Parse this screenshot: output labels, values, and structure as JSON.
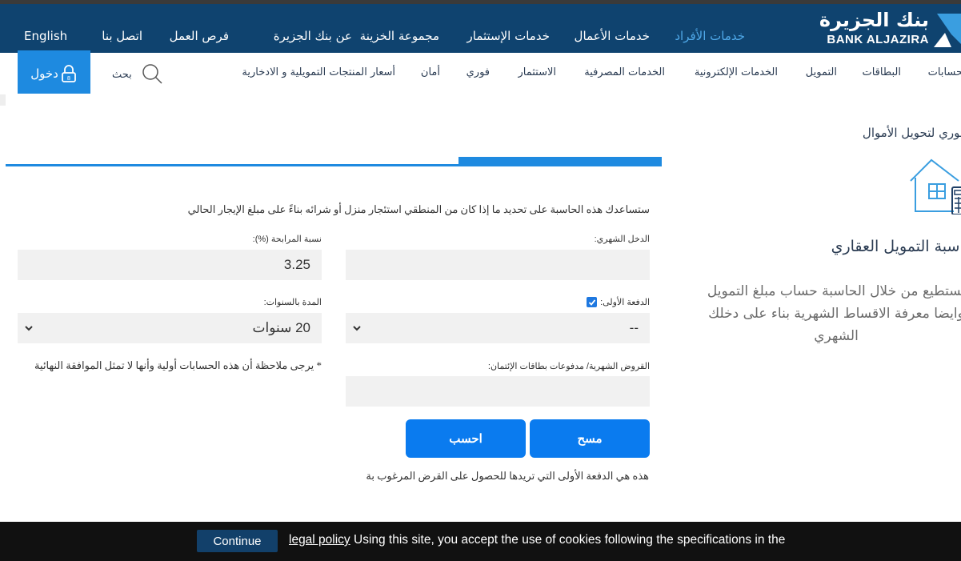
{
  "header": {
    "logo_ar": "بنك الجزيرة",
    "logo_en": "BANK ALJAZIRA",
    "nav": [
      {
        "label": "خدمات الأفراد",
        "active": true
      },
      {
        "label": "خدمات الأعمال",
        "active": false
      },
      {
        "label": "خدمات الإستثمار",
        "active": false
      },
      {
        "label": "مجموعة الخزينة",
        "active": false
      },
      {
        "label": "عن بنك الجزيرة",
        "active": false
      },
      {
        "label": "فرص العمل",
        "active": false
      },
      {
        "label": "اتصل بنا",
        "active": false
      },
      {
        "label": "English",
        "active": false
      }
    ],
    "accent_color": "#1e8ae0",
    "bar_color": "#0f436f"
  },
  "subnav": {
    "items": [
      "الحسابات",
      "البطاقات",
      "التمويل",
      "الخدمات الإلكترونية",
      "الخدمات المصرفية",
      "الاستثمار",
      "فوري",
      "أمان",
      "أسعار المنتجات التمويلية و الادخارية"
    ],
    "search_label": "بحث",
    "login_label": "دخول"
  },
  "sidebar": {
    "link": "فوري لتحويل الأموال",
    "title": "حاسبة التمويل العقاري",
    "description": "تستطيع من خلال الحاسبة حساب مبلغ التمويل وايضا معرفة الاقساط الشهرية بناء على دخلك الشهري"
  },
  "calculator": {
    "progress_fraction": 0.31,
    "intro": "ستساعدك هذه الحاسبة على تحديد ما إذا كان من المنطقي استئجار منزل أو شرائه بناءً على مبلغ الإيجار الحالي",
    "monthly_income": {
      "label": "الدخل الشهري:",
      "value": ""
    },
    "profit_rate": {
      "label": "نسبة المرابحة (%):",
      "value": "3.25"
    },
    "down_payment": {
      "label": "الدفعة الأولى:",
      "checked": true,
      "selected": "--"
    },
    "duration": {
      "label": "المدة بالسنوات:",
      "selected": "20 سنوات"
    },
    "monthly_loans": {
      "label": "القروض الشهرية/ مدفوعات بطاقات الإئتمان:",
      "value": ""
    },
    "note": "* يرجى ملاحظة أن هذه الحسابات أولية وأنها لا تمثل الموافقة النهائية",
    "clear_label": "مسح",
    "calculate_label": "احسب",
    "hint": "هذه هي الدفعة الأولى التي تريدها للحصول على القرض المرغوب بة"
  },
  "cookie": {
    "continue_label": "Continue",
    "link_label": "legal policy",
    "text": " Using this site, you accept the use of cookies following the specifications in the"
  }
}
